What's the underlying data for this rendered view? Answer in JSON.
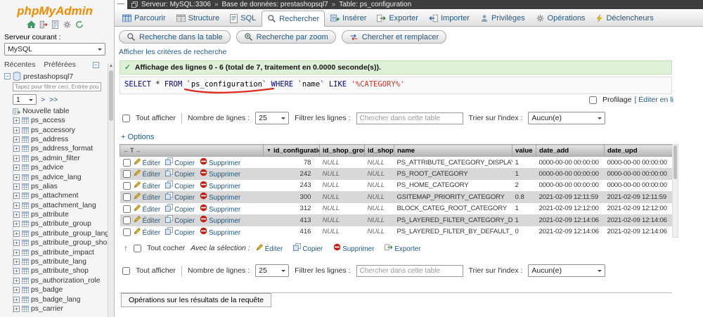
{
  "icons": {
    "minimize": "—",
    "breadcrumb_sep": "»",
    "check": "✓",
    "sort_desc": "▼",
    "col_left": "←",
    "col_mid": "T",
    "col_right": "→",
    "check_all_arrow": "↑",
    "collapse_minus": "−",
    "link_infinity": "∞",
    "expand_plus": "+",
    "scroll_up": "▲",
    "page_gt": ">",
    "page_gtgt": ">>"
  },
  "sidebar": {
    "logo": "phpMyAdmin",
    "icon_bar": [
      {
        "icon": "home",
        "name": "home-icon"
      },
      {
        "icon": "exit",
        "name": "logout-icon"
      },
      {
        "icon": "docs",
        "name": "docs-icon"
      },
      {
        "icon": "operations",
        "name": "settings-icon"
      },
      {
        "icon": "refresh",
        "name": "refresh-icon"
      }
    ],
    "server_label": "Serveur courant :",
    "server_value": "MySQL",
    "recent_label": "Récentes",
    "favorites_label": "Préférées",
    "database": "prestashopsql7",
    "filter_placeholder": "Tapez pour filtrer ceci, Entrée pour X",
    "page_value": "1",
    "new_table_label": "Nouvelle table",
    "tables": [
      "ps_access",
      "ps_accessory",
      "ps_address",
      "ps_address_format",
      "ps_admin_filter",
      "ps_advice",
      "ps_advice_lang",
      "ps_alias",
      "ps_attachment",
      "ps_attachment_lang",
      "ps_attribute",
      "ps_attribute_group",
      "ps_attribute_group_lang",
      "ps_attribute_group_shop",
      "ps_attribute_impact",
      "ps_attribute_lang",
      "ps_attribute_shop",
      "ps_authorization_role",
      "ps_badge",
      "ps_badge_lang",
      "ps_carrier"
    ]
  },
  "breadcrumb": {
    "server": "Serveur: MySQL:3306",
    "database": "Base de données: prestashopsql7",
    "table": "Table: ps_configuration",
    "separator": "»"
  },
  "tabs": [
    {
      "name": "parcourir",
      "label": "Parcourir",
      "icon": "browse",
      "active": false
    },
    {
      "name": "structure",
      "label": "Structure",
      "icon": "structure",
      "active": false
    },
    {
      "name": "sql",
      "label": "SQL",
      "icon": "sql",
      "active": false
    },
    {
      "name": "rechercher",
      "label": "Rechercher",
      "icon": "search",
      "active": true
    },
    {
      "name": "inserer",
      "label": "Insérer",
      "icon": "insert",
      "active": false
    },
    {
      "name": "exporter",
      "label": "Exporter",
      "icon": "export",
      "active": false
    },
    {
      "name": "importer",
      "label": "Importer",
      "icon": "import",
      "active": false
    },
    {
      "name": "privileges",
      "label": "Privilèges",
      "icon": "privileges",
      "active": false
    },
    {
      "name": "operations",
      "label": "Opérations",
      "icon": "operations",
      "active": false
    },
    {
      "name": "declencheurs",
      "label": "Déclencheurs",
      "icon": "triggers",
      "active": false
    }
  ],
  "subtabs": [
    {
      "name": "table-search",
      "label": "Recherche dans la table",
      "icon": "search"
    },
    {
      "name": "zoom-search",
      "label": "Recherche par zoom",
      "icon": "zoom"
    },
    {
      "name": "find-replace",
      "label": "Chercher et remplacer",
      "icon": "replace"
    }
  ],
  "search": {
    "criteria_link": "Afficher les critères de recherche"
  },
  "message": {
    "text": "Affichage des lignes 0 - 6 (total de 7, traitement en 0.0000 seconde(s))."
  },
  "sql": {
    "parts": [
      {
        "cls": "kw",
        "text": "SELECT"
      },
      {
        "cls": "id",
        "text": " * "
      },
      {
        "cls": "kw",
        "text": "FROM"
      },
      {
        "cls": "id",
        "text": " `ps_configuration` "
      },
      {
        "cls": "kw",
        "text": "WHERE"
      },
      {
        "cls": "id",
        "text": " `name` "
      },
      {
        "cls": "kw",
        "text": "LIKE"
      },
      {
        "cls": "str",
        "text": " '%CATEGORY%'"
      }
    ]
  },
  "profiling": {
    "label": "Profilage",
    "edit_link": "[ Éditer en li"
  },
  "controls": {
    "show_all": "Tout afficher",
    "rows_label": "Nombre de lignes :",
    "rows_value": "25",
    "filter_label": "Filtrer les lignes :",
    "filter_placeholder": "Chercher dans cette table",
    "sort_label": "Trier sur l'index :",
    "sort_value": "Aucun(e)"
  },
  "options_label": "+ Options",
  "table": {
    "headers": [
      "id_configuration",
      "id_shop_group",
      "id_shop",
      "name",
      "value",
      "date_add",
      "date_upd"
    ],
    "actions": {
      "edit": "Éditer",
      "copy": "Copier",
      "delete": "Supprimer"
    },
    "rows": [
      {
        "id_configuration": "78",
        "id_shop_group": "NULL",
        "id_shop": "NULL",
        "name": "PS_ATTRIBUTE_CATEGORY_DISPLAY",
        "value": "1",
        "date_add": "0000-00-00 00:00:00",
        "date_upd": "0000-00-00 00:00:00"
      },
      {
        "id_configuration": "242",
        "id_shop_group": "NULL",
        "id_shop": "NULL",
        "name": "PS_ROOT_CATEGORY",
        "value": "1",
        "date_add": "0000-00-00 00:00:00",
        "date_upd": "0000-00-00 00:00:00"
      },
      {
        "id_configuration": "243",
        "id_shop_group": "NULL",
        "id_shop": "NULL",
        "name": "PS_HOME_CATEGORY",
        "value": "2",
        "date_add": "0000-00-00 00:00:00",
        "date_upd": "0000-00-00 00:00:00"
      },
      {
        "id_configuration": "300",
        "id_shop_group": "NULL",
        "id_shop": "NULL",
        "name": "GSITEMAP_PRIORITY_CATEGORY",
        "value": "0.8",
        "date_add": "2021-02-09 12:11:59",
        "date_upd": "2021-02-09 12:11:59"
      },
      {
        "id_configuration": "312",
        "id_shop_group": "NULL",
        "id_shop": "NULL",
        "name": "BLOCK_CATEG_ROOT_CATEGORY",
        "value": "1",
        "date_add": "2021-02-09 12:12:00",
        "date_upd": "2021-02-09 12:12:00"
      },
      {
        "id_configuration": "413",
        "id_shop_group": "NULL",
        "id_shop": "NULL",
        "name": "PS_LAYERED_FILTER_CATEGORY_DEPTH",
        "value": "1",
        "date_add": "2021-02-09 12:14:06",
        "date_upd": "2021-02-09 12:14:06"
      },
      {
        "id_configuration": "416",
        "id_shop_group": "NULL",
        "id_shop": "NULL",
        "name": "PS_LAYERED_FILTER_BY_DEFAULT_CATEGORY",
        "value": "0",
        "date_add": "2021-02-09 12:14:06",
        "date_upd": "2021-02-09 12:14:06"
      }
    ]
  },
  "footer": {
    "check_all": "Tout cocher",
    "with_selection": "Avec la sélection :",
    "edit": "Éditer",
    "copy": "Copier",
    "delete": "Supprimer",
    "export": "Exporter"
  },
  "query_ops_label": "Opérations sur les résultats de la requête"
}
